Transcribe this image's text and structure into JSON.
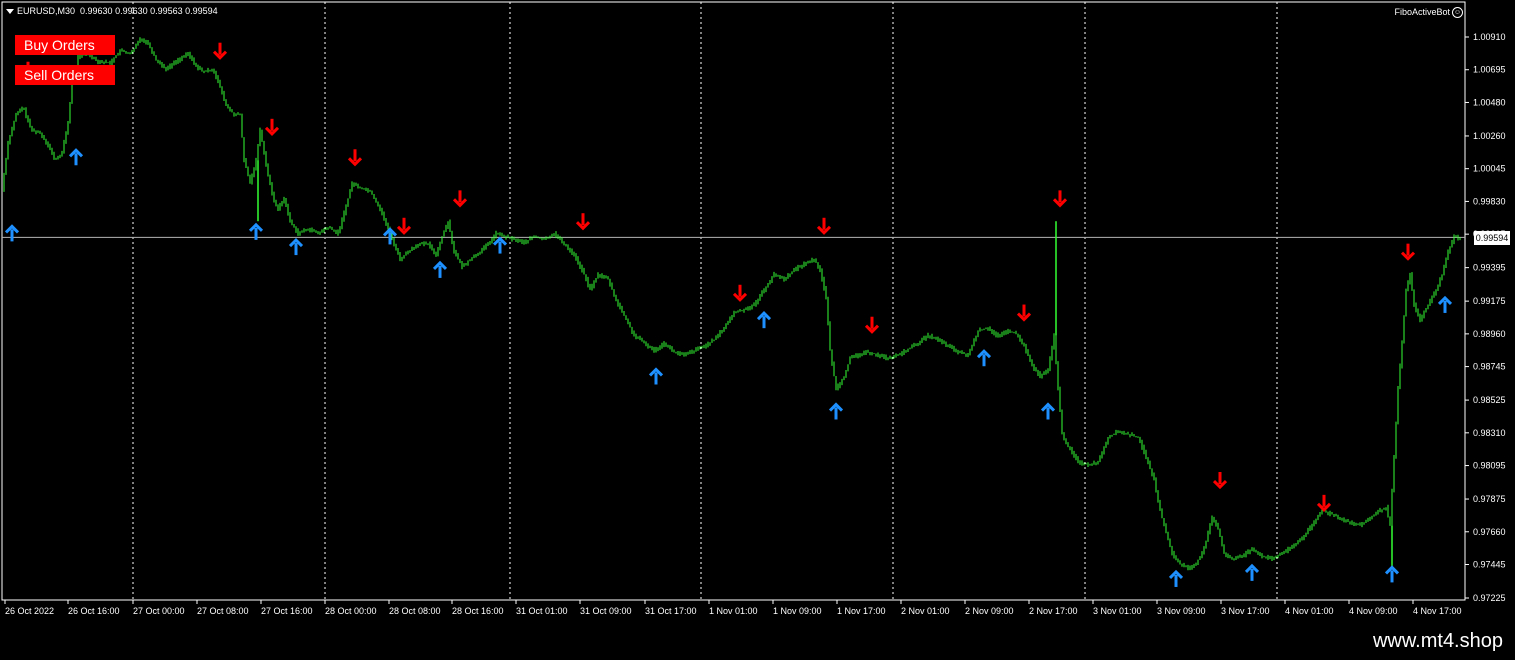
{
  "header": {
    "symbol": "EURUSD,M30",
    "ohlc": "0.99630 0.99630 0.99563 0.99594"
  },
  "buttons": {
    "buy": "Buy Orders",
    "sell": "Sell Orders"
  },
  "indicator": {
    "label": "FiboActiveBot",
    "icon": "smiley-icon"
  },
  "current_price_label": "0.99594",
  "watermark": "www.mt4.shop",
  "colors": {
    "background": "#000000",
    "candles": "#33ff33",
    "up_arrow": "#1e90ff",
    "down_arrow": "#ff0000",
    "buttons": "#ff0000"
  },
  "chart_data": {
    "type": "candlestick",
    "grid": true,
    "y_tick_labels": [
      "1.00910",
      "1.00695",
      "1.00480",
      "1.00260",
      "1.00045",
      "0.99830",
      "0.99615",
      "0.99395",
      "0.99175",
      "0.98960",
      "0.98745",
      "0.98525",
      "0.98310",
      "0.98095",
      "0.97875",
      "0.97660",
      "0.97445",
      "0.97225"
    ],
    "x_tick_labels": [
      "26 Oct 2022",
      "26 Oct 16:00",
      "27 Oct 00:00",
      "27 Oct 08:00",
      "27 Oct 16:00",
      "28 Oct 00:00",
      "28 Oct 08:00",
      "28 Oct 16:00",
      "31 Oct 01:00",
      "31 Oct 09:00",
      "31 Oct 17:00",
      "1 Nov 01:00",
      "1 Nov 09:00",
      "1 Nov 17:00",
      "2 Nov 01:00",
      "2 Nov 09:00",
      "2 Nov 17:00",
      "3 Nov 01:00",
      "3 Nov 09:00",
      "3 Nov 17:00",
      "4 Nov 01:00",
      "4 Nov 09:00",
      "4 Nov 17:00"
    ],
    "ylim": [
      0.97225,
      1.0091
    ],
    "current_price": 0.99594,
    "price_path": [
      [
        0,
        0.9975
      ],
      [
        3,
        0.9985
      ],
      [
        10,
        1.0022
      ],
      [
        18,
        1.004
      ],
      [
        25,
        1.0045
      ],
      [
        33,
        1.003
      ],
      [
        42,
        1.0028
      ],
      [
        50,
        1.002
      ],
      [
        57,
        1.001
      ],
      [
        64,
        1.0015
      ],
      [
        70,
        1.0035
      ],
      [
        74,
        1.006
      ],
      [
        80,
        1.0078
      ],
      [
        90,
        1.008
      ],
      [
        100,
        1.0075
      ],
      [
        112,
        1.0074
      ],
      [
        122,
        1.0082
      ],
      [
        133,
        1.008
      ],
      [
        142,
        1.009
      ],
      [
        150,
        1.0087
      ],
      [
        158,
        1.0076
      ],
      [
        168,
        1.007
      ],
      [
        178,
        1.0075
      ],
      [
        190,
        1.008
      ],
      [
        198,
        1.0072
      ],
      [
        205,
        1.0068
      ],
      [
        215,
        1.007
      ],
      [
        222,
        1.0058
      ],
      [
        228,
        1.0046
      ],
      [
        236,
        1.004
      ],
      [
        242,
        1.004
      ],
      [
        246,
        1.001
      ],
      [
        252,
        0.9995
      ],
      [
        258,
        1.001
      ],
      [
        262,
        1.003
      ],
      [
        266,
        1.0015
      ],
      [
        270,
        1.0
      ],
      [
        275,
        0.9985
      ],
      [
        280,
        0.9978
      ],
      [
        286,
        0.9985
      ],
      [
        292,
        0.997
      ],
      [
        300,
        0.9962
      ],
      [
        310,
        0.9965
      ],
      [
        320,
        0.9962
      ],
      [
        330,
        0.9966
      ],
      [
        340,
        0.9962
      ],
      [
        348,
        0.998
      ],
      [
        354,
        0.9995
      ],
      [
        362,
        0.9992
      ],
      [
        372,
        0.999
      ],
      [
        382,
        0.9978
      ],
      [
        390,
        0.9965
      ],
      [
        396,
        0.9955
      ],
      [
        402,
        0.9945
      ],
      [
        410,
        0.995
      ],
      [
        420,
        0.9955
      ],
      [
        430,
        0.9955
      ],
      [
        438,
        0.9948
      ],
      [
        444,
        0.996
      ],
      [
        450,
        0.997
      ],
      [
        456,
        0.995
      ],
      [
        464,
        0.994
      ],
      [
        472,
        0.9945
      ],
      [
        482,
        0.995
      ],
      [
        490,
        0.9955
      ],
      [
        498,
        0.9962
      ],
      [
        506,
        0.996
      ],
      [
        516,
        0.9958
      ],
      [
        526,
        0.9956
      ],
      [
        536,
        0.996
      ],
      [
        546,
        0.9958
      ],
      [
        556,
        0.9962
      ],
      [
        566,
        0.9955
      ],
      [
        576,
        0.9948
      ],
      [
        586,
        0.9935
      ],
      [
        592,
        0.9925
      ],
      [
        600,
        0.9935
      ],
      [
        610,
        0.9932
      ],
      [
        618,
        0.9918
      ],
      [
        626,
        0.9908
      ],
      [
        636,
        0.9895
      ],
      [
        646,
        0.989
      ],
      [
        656,
        0.9885
      ],
      [
        666,
        0.989
      ],
      [
        676,
        0.9884
      ],
      [
        686,
        0.9882
      ],
      [
        696,
        0.9885
      ],
      [
        706,
        0.9888
      ],
      [
        716,
        0.9892
      ],
      [
        726,
        0.99
      ],
      [
        736,
        0.991
      ],
      [
        746,
        0.9912
      ],
      [
        756,
        0.9915
      ],
      [
        766,
        0.9925
      ],
      [
        776,
        0.9935
      ],
      [
        786,
        0.9932
      ],
      [
        796,
        0.9938
      ],
      [
        806,
        0.9942
      ],
      [
        816,
        0.9945
      ],
      [
        822,
        0.9938
      ],
      [
        828,
        0.992
      ],
      [
        832,
        0.9885
      ],
      [
        838,
        0.986
      ],
      [
        846,
        0.9868
      ],
      [
        852,
        0.988
      ],
      [
        860,
        0.9882
      ],
      [
        870,
        0.9884
      ],
      [
        880,
        0.9882
      ],
      [
        890,
        0.988
      ],
      [
        900,
        0.9882
      ],
      [
        910,
        0.9886
      ],
      [
        920,
        0.989
      ],
      [
        930,
        0.9895
      ],
      [
        940,
        0.9892
      ],
      [
        950,
        0.9888
      ],
      [
        960,
        0.9884
      ],
      [
        970,
        0.9882
      ],
      [
        980,
        0.9898
      ],
      [
        990,
        0.99
      ],
      [
        1000,
        0.9894
      ],
      [
        1010,
        0.9898
      ],
      [
        1018,
        0.9896
      ],
      [
        1026,
        0.9888
      ],
      [
        1034,
        0.9875
      ],
      [
        1042,
        0.9868
      ],
      [
        1050,
        0.9872
      ],
      [
        1056,
        0.9895
      ],
      [
        1060,
        0.986
      ],
      [
        1064,
        0.983
      ],
      [
        1070,
        0.9822
      ],
      [
        1080,
        0.9812
      ],
      [
        1090,
        0.981
      ],
      [
        1100,
        0.9812
      ],
      [
        1110,
        0.9828
      ],
      [
        1120,
        0.9832
      ],
      [
        1130,
        0.983
      ],
      [
        1140,
        0.9828
      ],
      [
        1148,
        0.9815
      ],
      [
        1156,
        0.98
      ],
      [
        1162,
        0.978
      ],
      [
        1168,
        0.9765
      ],
      [
        1175,
        0.975
      ],
      [
        1182,
        0.9745
      ],
      [
        1190,
        0.9742
      ],
      [
        1198,
        0.9745
      ],
      [
        1206,
        0.9755
      ],
      [
        1214,
        0.9775
      ],
      [
        1220,
        0.9768
      ],
      [
        1226,
        0.9752
      ],
      [
        1234,
        0.9748
      ],
      [
        1244,
        0.975
      ],
      [
        1254,
        0.9755
      ],
      [
        1264,
        0.975
      ],
      [
        1274,
        0.9748
      ],
      [
        1284,
        0.9752
      ],
      [
        1294,
        0.9756
      ],
      [
        1304,
        0.9762
      ],
      [
        1314,
        0.977
      ],
      [
        1324,
        0.978
      ],
      [
        1332,
        0.9778
      ],
      [
        1342,
        0.9775
      ],
      [
        1352,
        0.9772
      ],
      [
        1362,
        0.977
      ],
      [
        1372,
        0.9775
      ],
      [
        1382,
        0.978
      ],
      [
        1388,
        0.9782
      ],
      [
        1392,
        0.977
      ],
      [
        1396,
        0.9815
      ],
      [
        1400,
        0.986
      ],
      [
        1404,
        0.989
      ],
      [
        1408,
        0.9925
      ],
      [
        1412,
        0.9935
      ],
      [
        1416,
        0.9915
      ],
      [
        1422,
        0.9905
      ],
      [
        1430,
        0.9915
      ],
      [
        1438,
        0.9925
      ],
      [
        1444,
        0.9935
      ],
      [
        1450,
        0.995
      ],
      [
        1456,
        0.996
      ],
      [
        1460,
        0.9959
      ]
    ],
    "spikes": [
      [
        1056,
        0.997
      ],
      [
        1392,
        0.9742
      ],
      [
        258,
        0.997
      ]
    ],
    "signals": [
      {
        "type": "sell",
        "x": 28,
        "price": 1.00695
      },
      {
        "type": "buy",
        "x": 76,
        "price": 1.0012
      },
      {
        "type": "buy",
        "x": 12,
        "price": 0.9962
      },
      {
        "type": "sell",
        "x": 220,
        "price": 1.0082
      },
      {
        "type": "sell",
        "x": 272,
        "price": 1.0032
      },
      {
        "type": "buy",
        "x": 256,
        "price": 0.9963
      },
      {
        "type": "buy",
        "x": 296,
        "price": 0.9953
      },
      {
        "type": "sell",
        "x": 355,
        "price": 1.0012
      },
      {
        "type": "buy",
        "x": 390,
        "price": 0.996
      },
      {
        "type": "sell",
        "x": 404,
        "price": 0.9967
      },
      {
        "type": "sell",
        "x": 460,
        "price": 0.9985
      },
      {
        "type": "buy",
        "x": 440,
        "price": 0.9938
      },
      {
        "type": "buy",
        "x": 500,
        "price": 0.9954
      },
      {
        "type": "sell",
        "x": 583,
        "price": 0.997
      },
      {
        "type": "buy",
        "x": 656,
        "price": 0.9868
      },
      {
        "type": "sell",
        "x": 740,
        "price": 0.9923
      },
      {
        "type": "buy",
        "x": 764,
        "price": 0.9905
      },
      {
        "type": "sell",
        "x": 824,
        "price": 0.9967
      },
      {
        "type": "sell",
        "x": 872,
        "price": 0.9902
      },
      {
        "type": "buy",
        "x": 836,
        "price": 0.9845
      },
      {
        "type": "buy",
        "x": 984,
        "price": 0.988
      },
      {
        "type": "sell",
        "x": 1024,
        "price": 0.991
      },
      {
        "type": "buy",
        "x": 1048,
        "price": 0.9845
      },
      {
        "type": "sell",
        "x": 1060,
        "price": 0.9985
      },
      {
        "type": "buy",
        "x": 1176,
        "price": 0.9735
      },
      {
        "type": "sell",
        "x": 1220,
        "price": 0.98
      },
      {
        "type": "buy",
        "x": 1252,
        "price": 0.9739
      },
      {
        "type": "sell",
        "x": 1324,
        "price": 0.9785
      },
      {
        "type": "buy",
        "x": 1392,
        "price": 0.9738
      },
      {
        "type": "sell",
        "x": 1408,
        "price": 0.995
      },
      {
        "type": "buy",
        "x": 1445,
        "price": 0.9915
      }
    ]
  }
}
